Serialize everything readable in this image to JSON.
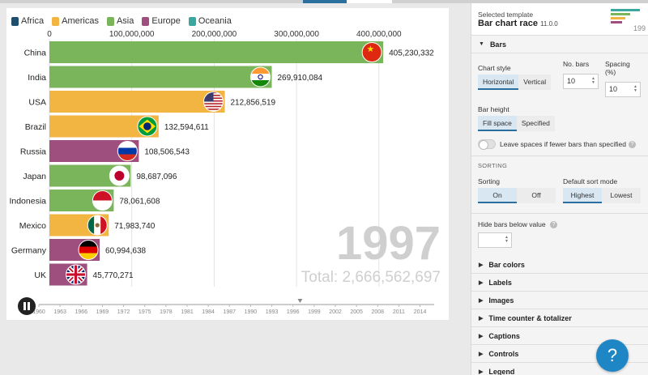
{
  "colors": {
    "Africa": "#1f4e6f",
    "Americas": "#f2b541",
    "Asia": "#7ab55c",
    "Europe": "#9e4f7d",
    "Oceania": "#3aa6a0"
  },
  "legend": [
    "Africa",
    "Americas",
    "Asia",
    "Europe",
    "Oceania"
  ],
  "chart_data": {
    "type": "bar",
    "orientation": "horizontal",
    "categories": [
      "China",
      "India",
      "USA",
      "Brazil",
      "Russia",
      "Japan",
      "Indonesia",
      "Mexico",
      "Germany",
      "UK"
    ],
    "values": [
      405230332,
      269910084,
      212856519,
      132594611,
      108506543,
      98687096,
      78061608,
      71983740,
      60994638,
      45770271
    ],
    "value_labels": [
      "405,230,332",
      "269,910,084",
      "212,856,519",
      "132,594,611",
      "108,506,543",
      "98,687,096",
      "78,061,608",
      "71,983,740",
      "60,994,638",
      "45,770,271"
    ],
    "region": [
      "Asia",
      "Asia",
      "Americas",
      "Americas",
      "Europe",
      "Asia",
      "Asia",
      "Americas",
      "Europe",
      "Europe"
    ],
    "flag_icons": [
      "china-flag-icon",
      "india-flag-icon",
      "usa-flag-icon",
      "brazil-flag-icon",
      "russia-flag-icon",
      "japan-flag-icon",
      "indonesia-flag-icon",
      "mexico-flag-icon",
      "germany-flag-icon",
      "uk-flag-icon"
    ],
    "xlim": [
      0,
      470000000
    ],
    "x_ticks": [
      0,
      100000000,
      200000000,
      300000000,
      400000000
    ],
    "x_tick_labels": [
      "0",
      "100,000,000",
      "200,000,000",
      "300,000,000",
      "400,000,000"
    ],
    "grid": true,
    "legend_position": "top-left",
    "current_year": "1997",
    "total_text": "Total: 2,666,562,697",
    "timeline": {
      "start": 1960,
      "end": 2016,
      "current": 1997,
      "ticks": [
        "1960",
        "1963",
        "1966",
        "1969",
        "1972",
        "1975",
        "1978",
        "1981",
        "1984",
        "1987",
        "1990",
        "1993",
        "1996",
        "1999",
        "2002",
        "2005",
        "2008",
        "2011",
        "2014"
      ]
    }
  },
  "panel": {
    "selected_template_label": "Selected template",
    "template_name": "Bar chart race",
    "template_version": "11.0.0",
    "thumb_text": "199",
    "bars": {
      "title": "Bars",
      "chart_style_label": "Chart style",
      "chart_style_options": [
        "Horizontal",
        "Vertical"
      ],
      "no_bars_label": "No. bars",
      "no_bars_value": "10",
      "spacing_label": "Spacing (%)",
      "spacing_value": "10",
      "bar_height_label": "Bar height",
      "bar_height_options": [
        "Fill space",
        "Specified"
      ],
      "leave_spaces_label": "Leave spaces if fewer bars than specified",
      "sorting_caption": "SORTING",
      "sorting_label": "Sorting",
      "sorting_options": [
        "On",
        "Off"
      ],
      "default_sort_label": "Default sort mode",
      "default_sort_options": [
        "Highest",
        "Lowest"
      ],
      "hide_bars_label": "Hide bars below value"
    },
    "sections": [
      "Bar colors",
      "Labels",
      "Images",
      "Time counter & totalizer",
      "Captions",
      "Controls",
      "Legend"
    ]
  },
  "help_button": "?"
}
